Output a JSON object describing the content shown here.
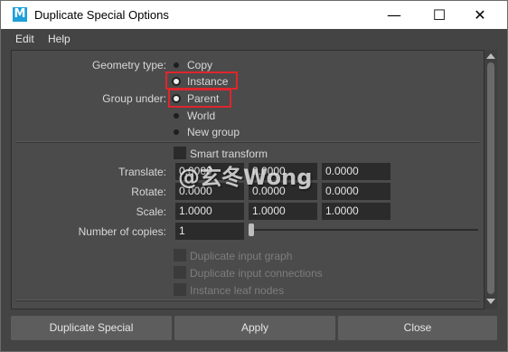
{
  "window": {
    "title": "Duplicate Special Options",
    "app_icon_letter": "M",
    "controls": {
      "minimize": "—",
      "maximize": "☐",
      "close": "✕"
    }
  },
  "menu": [
    "Edit",
    "Help"
  ],
  "geometry_type": {
    "label": "Geometry type:",
    "options": [
      "Copy",
      "Instance"
    ],
    "selected": "Instance"
  },
  "group_under": {
    "label": "Group under:",
    "options": [
      "Parent",
      "World",
      "New group"
    ],
    "selected": "Parent"
  },
  "smart_transform": {
    "label": "Smart transform",
    "checked": false
  },
  "translate": {
    "label": "Translate:",
    "values": [
      "0.0000",
      "0.0000",
      "0.0000"
    ]
  },
  "rotate": {
    "label": "Rotate:",
    "values": [
      "0.0000",
      "0.0000",
      "0.0000"
    ]
  },
  "scale": {
    "label": "Scale:",
    "values": [
      "1.0000",
      "1.0000",
      "1.0000"
    ]
  },
  "copies": {
    "label": "Number of copies:",
    "value": "1"
  },
  "disabled_options": [
    "Duplicate input graph",
    "Duplicate input connections",
    "Instance leaf nodes"
  ],
  "buttons": {
    "duplicate": "Duplicate Special",
    "apply": "Apply",
    "close": "Close"
  },
  "watermark": "@玄冬Wong",
  "colors": {
    "highlight": "#e0252b",
    "icon": "#1e9fd7"
  }
}
